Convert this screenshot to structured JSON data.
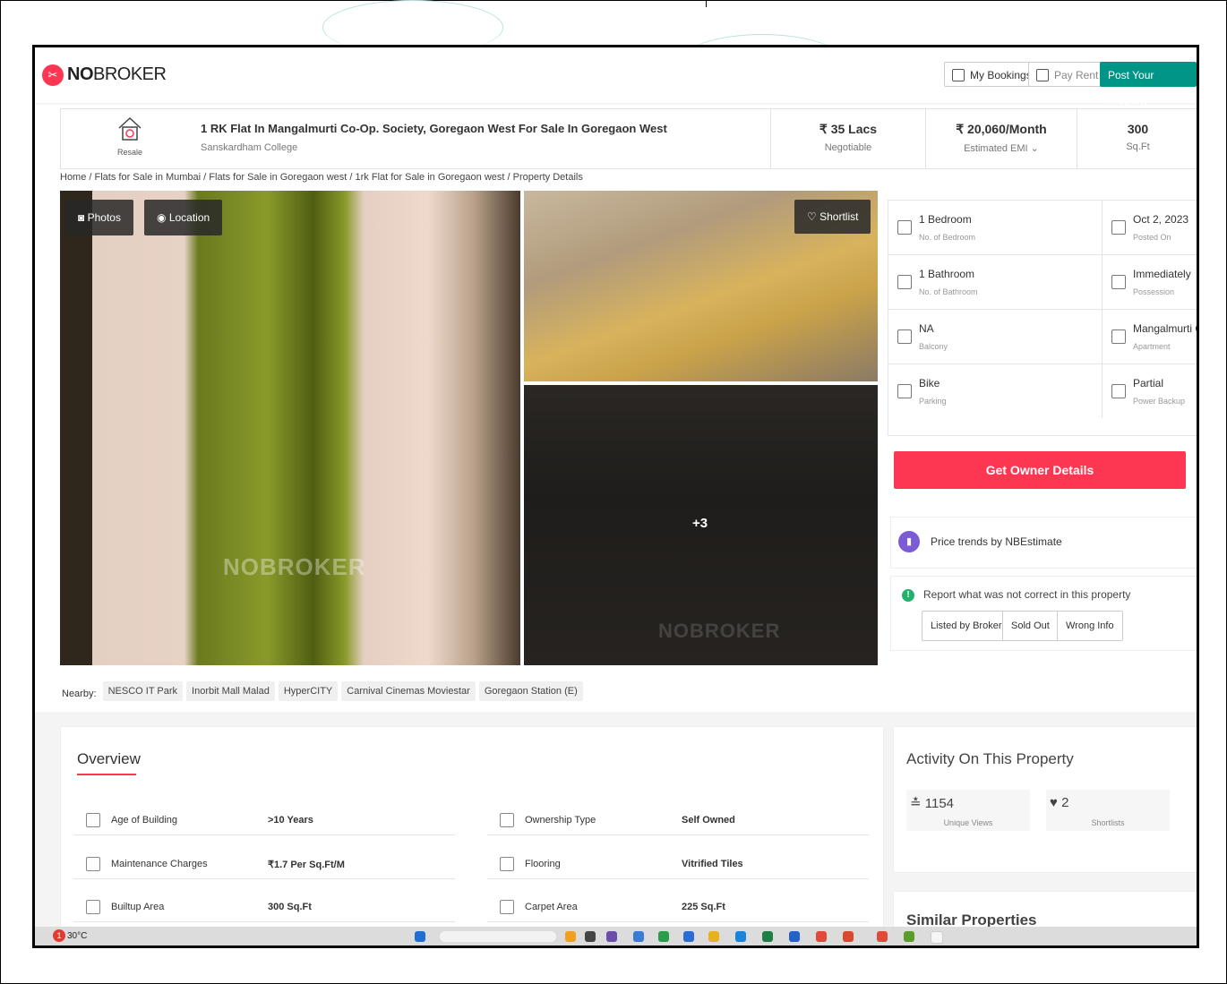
{
  "header": {
    "brand_prefix": "NO",
    "brand_suffix": "BROKER",
    "my_bookings": "My Bookings",
    "pay_rent": "Pay Rent",
    "post_property": "Post Your Property"
  },
  "property": {
    "type_label": "Resale",
    "title": "1 RK Flat In Mangalmurti Co-Op. Society, Goregaon West For Sale In Goregaon West",
    "locality": "Sanskardham College",
    "price": "₹ 35 Lacs",
    "price_note": "Negotiable",
    "emi": "₹ 20,060/Month",
    "emi_note": "Estimated EMI ⌄",
    "area": "300",
    "area_unit": "Sq.Ft"
  },
  "breadcrumb": "Home / Flats for Sale in Mumbai / Flats for Sale in Goregaon west / 1rk Flat for Sale in Goregaon west / Property Details",
  "gallery": {
    "photos": "Photos",
    "location": "Location",
    "shortlist": "Shortlist",
    "more": "+3",
    "watermark": "NOBROKER"
  },
  "facts": [
    {
      "value": "1 Bedroom",
      "label": "No. of Bedroom"
    },
    {
      "value": "Oct 2, 2023",
      "label": "Posted On"
    },
    {
      "value": "1 Bathroom",
      "label": "No. of Bathroom"
    },
    {
      "value": "Immediately",
      "label": "Possession"
    },
    {
      "value": "NA",
      "label": "Balcony"
    },
    {
      "value": "Mangalmurti Co",
      "label": "Apartment"
    },
    {
      "value": "Bike",
      "label": "Parking"
    },
    {
      "value": "Partial",
      "label": "Power Backup"
    }
  ],
  "owner_button": "Get Owner Details",
  "price_trends": "Price trends by NBEstimate",
  "report": {
    "text": "Report what was not correct in this property",
    "listed_by_broker": "Listed by Broker",
    "sold_out": "Sold Out",
    "wrong_info": "Wrong Info"
  },
  "nearby": {
    "label": "Nearby:",
    "items": [
      "NESCO IT Park",
      "Inorbit Mall Malad",
      "HyperCITY",
      "Carnival Cinemas Moviestar",
      "Goregaon Station (E)"
    ]
  },
  "overview": {
    "title": "Overview",
    "rows": [
      {
        "label": "Age of Building",
        "value": ">10 Years"
      },
      {
        "label": "Ownership Type",
        "value": "Self Owned"
      },
      {
        "label": "Maintenance Charges",
        "value": "₹1.7 Per Sq.Ft/M"
      },
      {
        "label": "Flooring",
        "value": "Vitrified Tiles"
      },
      {
        "label": "Builtup Area",
        "value": "300 Sq.Ft"
      },
      {
        "label": "Carpet Area",
        "value": "225 Sq.Ft"
      }
    ]
  },
  "activity": {
    "title": "Activity On This Property",
    "views": "1154",
    "views_label": "Unique Views",
    "shortlists": "2",
    "shortlists_label": "Shortlists"
  },
  "similar_title": "Similar Properties",
  "taskbar": {
    "temperature": "30°C",
    "badge": "1"
  },
  "colors": {
    "brand_red": "#fd3752",
    "post_green": "#009587"
  }
}
